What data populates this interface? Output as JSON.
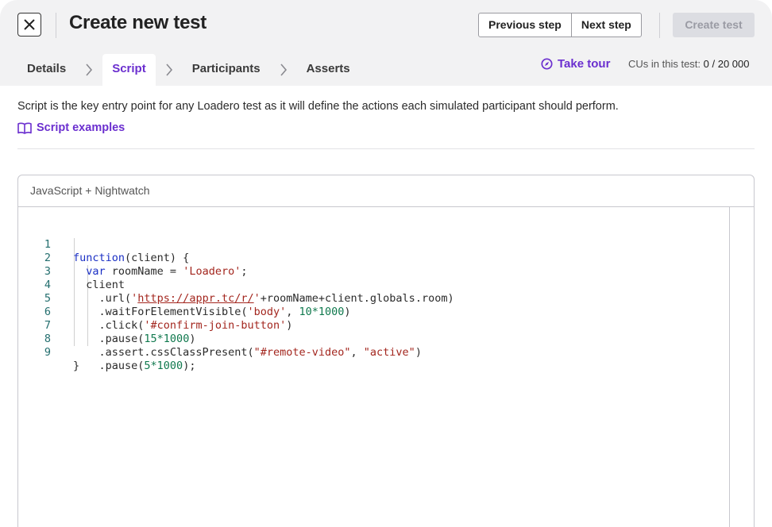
{
  "header": {
    "title": "Create new test",
    "prev_label": "Previous step",
    "next_label": "Next step",
    "create_label": "Create test"
  },
  "tabs": [
    {
      "label": "Details"
    },
    {
      "label": "Script",
      "active": true
    },
    {
      "label": "Participants"
    },
    {
      "label": "Asserts"
    }
  ],
  "tour_label": "Take tour",
  "cus": {
    "label": "CUs in this test:",
    "value": "0 / 20 000"
  },
  "description": "Script is the key entry point for any Loadero test as it will define the actions each simulated participant should perform.",
  "examples_label": "Script examples",
  "editor": {
    "language": "JavaScript + Nightwatch",
    "line_numbers": [
      "1",
      "2",
      "3",
      "4",
      "5",
      "6",
      "7",
      "8",
      "9"
    ]
  },
  "code": {
    "l1_kw": "function",
    "l1_rest": "(client) {",
    "l2_kw": "var",
    "l2_mid": " roomName = ",
    "l2_str": "'Loadero'",
    "l2_end": ";",
    "l3": "client",
    "l4_a": ".url(",
    "l4_q1": "'",
    "l4_url": "https://appr.tc/r/",
    "l4_q2": "'",
    "l4_b": "+roomName+client.globals.room)",
    "l5_a": ".waitForElementVisible(",
    "l5_str": "'body'",
    "l5_b": ", ",
    "l5_num": "10*1000",
    "l5_c": ")",
    "l6_a": ".click(",
    "l6_str": "'#confirm-join-button'",
    "l6_b": ")",
    "l7_a": ".pause(",
    "l7_num": "15*1000",
    "l7_b": ")",
    "l8_a": ".assert.cssClassPresent(",
    "l8_str1": "\"#remote-video\"",
    "l8_b": ", ",
    "l8_str2": "\"active\"",
    "l8_c": ")",
    "l9_a": ".pause(",
    "l9_num": "5*1000",
    "l9_b": ");",
    "l10": "}"
  },
  "colors": {
    "accent": "#6b2fcf",
    "header_bg": "#f2f2f3"
  }
}
